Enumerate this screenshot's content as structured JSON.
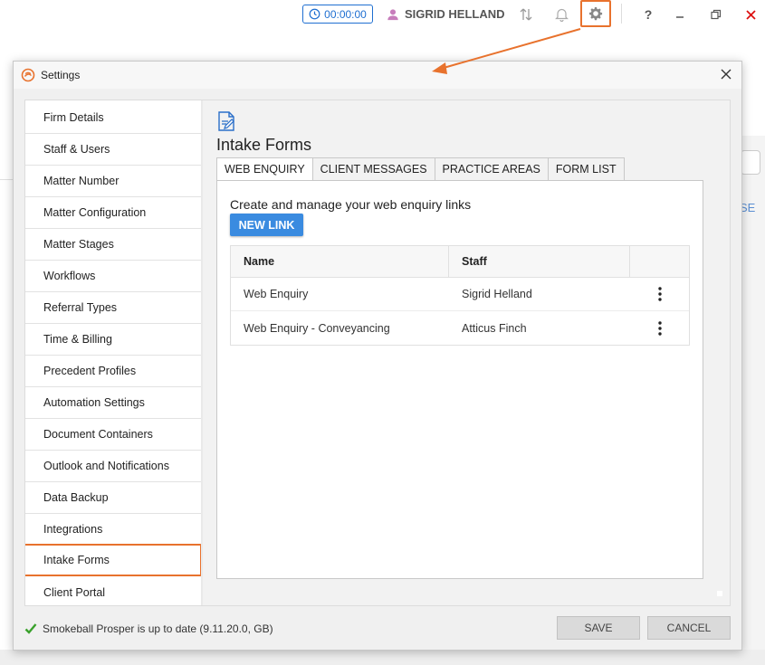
{
  "topbar": {
    "timer": "00:00:00",
    "user_name": "SIGRID HELLAND",
    "help_label": "?",
    "accent": "#e8722d"
  },
  "background": {
    "link_fragment": "SE"
  },
  "dialog": {
    "title": "Settings",
    "nav_items": [
      "Firm Details",
      "Staff & Users",
      "Matter Number",
      "Matter Configuration",
      "Matter Stages",
      "Workflows",
      "Referral Types",
      "Time & Billing",
      "Precedent Profiles",
      "Automation Settings",
      "Document Containers",
      "Outlook and Notifications",
      "Data Backup",
      "Integrations",
      "Intake Forms",
      "Client Portal"
    ],
    "active_nav": "Intake Forms",
    "page_title": "Intake Forms",
    "tabs": [
      "WEB ENQUIRY",
      "CLIENT MESSAGES",
      "PRACTICE AREAS",
      "FORM LIST"
    ],
    "active_tab": "WEB ENQUIRY",
    "panel": {
      "description": "Create and manage your web enquiry links",
      "new_link_label": "NEW LINK",
      "columns": [
        "Name",
        "Staff"
      ],
      "rows": [
        {
          "name": "Web Enquiry",
          "staff": "Sigrid Helland"
        },
        {
          "name": "Web Enquiry - Conveyancing",
          "staff": "Atticus Finch"
        }
      ]
    },
    "status_text": "Smokeball Prosper is up to date (9.11.20.0, GB)",
    "save_label": "SAVE",
    "cancel_label": "CANCEL"
  }
}
